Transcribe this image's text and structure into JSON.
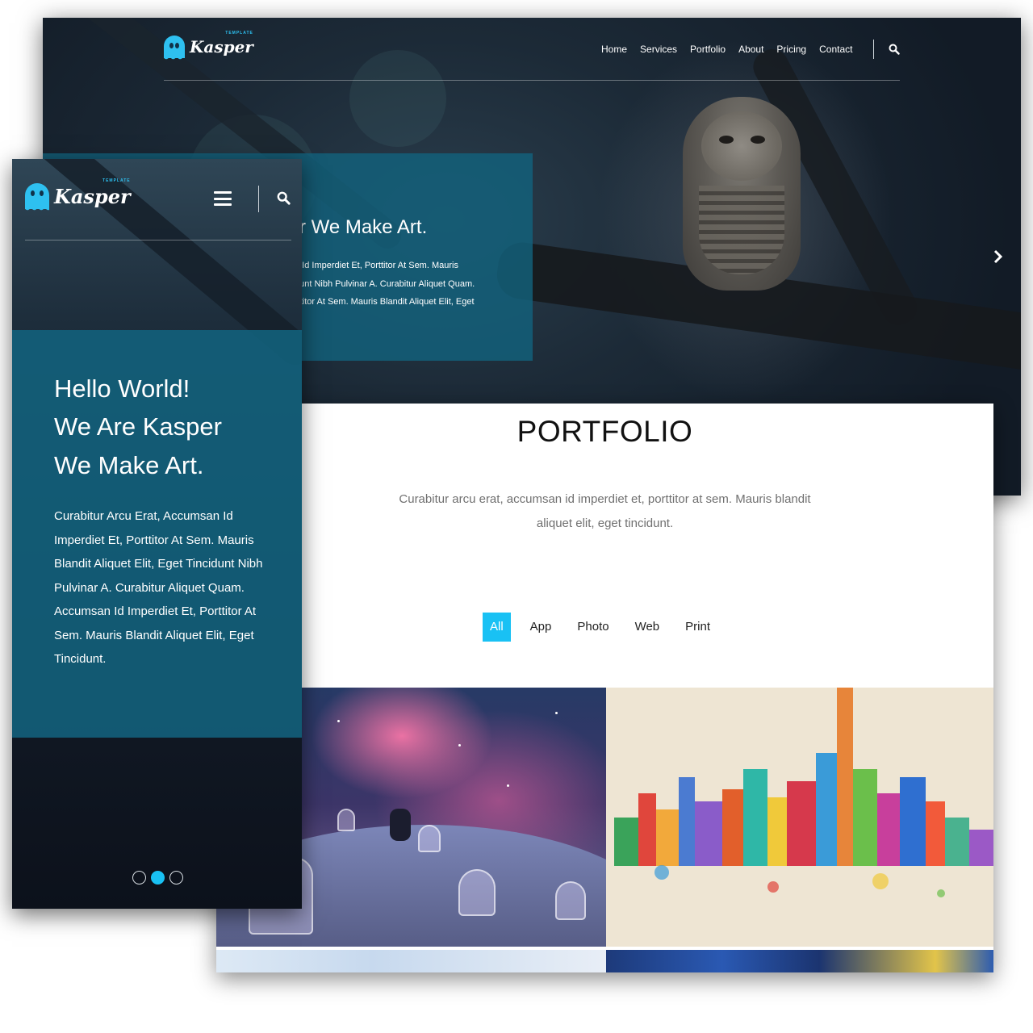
{
  "brand": {
    "name": "Kasper",
    "tagline": "TEMPLATE",
    "accent": "#19c1f4"
  },
  "desktop": {
    "nav": [
      "Home",
      "Services",
      "Portfolio",
      "About",
      "Pricing",
      "Contact"
    ],
    "hero_heading_partial": "r We Make Art.",
    "hero_lines": [
      "n Id Imperdiet Et, Porttitor At Sem. Mauris",
      "dunt Nibh Pulvinar A. Curabitur Aliquet Quam.",
      "rttitor At Sem. Mauris Blandit Aliquet Elit, Eget"
    ],
    "next_arrow": "›"
  },
  "portfolio": {
    "title": "PORTFOLIO",
    "subtitle": "Curabitur arcu erat, accumsan id imperdiet et, porttitor at sem. Mauris blandit aliquet elit, eget tincidunt.",
    "filters": [
      "All",
      "App",
      "Photo",
      "Web",
      "Print"
    ],
    "active_filter": "All"
  },
  "mobile": {
    "hero_lines": [
      "Hello World!",
      "We Are Kasper",
      "We Make Art."
    ],
    "hero_text": "Curabitur Arcu Erat, Accumsan Id Imperdiet Et, Porttitor At Sem. Mauris Blandit Aliquet Elit, Eget Tincidunt Nibh Pulvinar A. Curabitur Aliquet Quam. Accumsan Id Imperdiet Et, Porttitor At Sem. Mauris Blandit Aliquet Elit, Eget Tincidunt.",
    "slides": 3,
    "active_slide": 2
  },
  "icons": {
    "search": "search-icon",
    "menu": "hamburger-menu-icon",
    "next": "chevron-right-icon",
    "logo": "ghost-logo-icon"
  }
}
